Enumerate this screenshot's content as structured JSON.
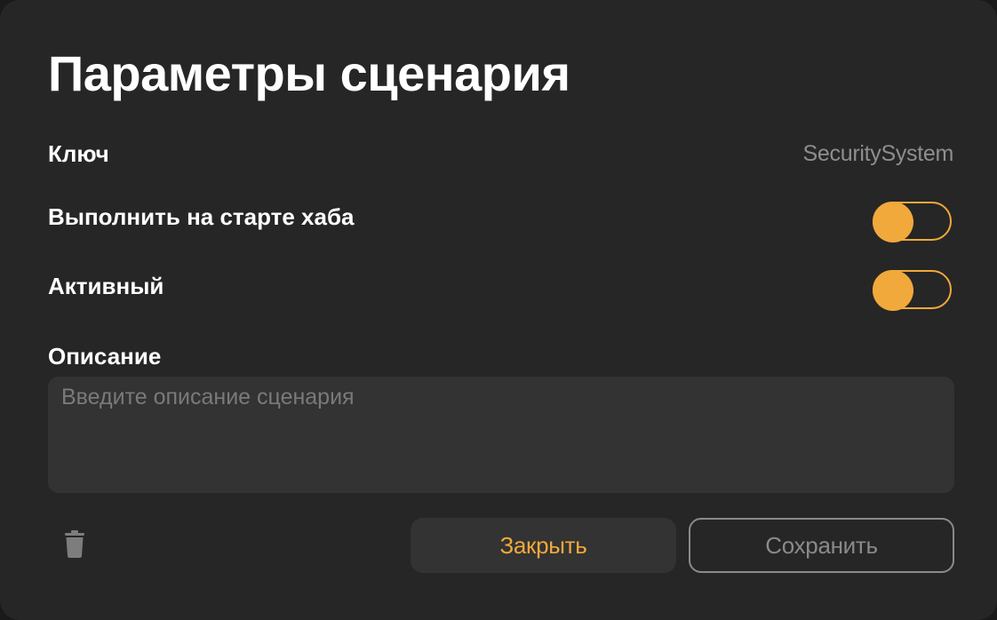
{
  "dialog": {
    "title": "Параметры сценария",
    "key": {
      "label": "Ключ",
      "value": "SecuritySystem"
    },
    "run_on_hub_start": {
      "label": "Выполнить на старте хаба",
      "enabled": false
    },
    "active": {
      "label": "Активный",
      "enabled": false
    },
    "description": {
      "label": "Описание",
      "value": "",
      "placeholder": "Введите описание сценария"
    },
    "actions": {
      "delete_icon": "trash-icon",
      "close_label": "Закрыть",
      "save_label": "Сохранить"
    }
  },
  "colors": {
    "background": "#262626",
    "accent": "#f2a93b",
    "field": "#333333",
    "muted_text": "#8e8e8e"
  }
}
